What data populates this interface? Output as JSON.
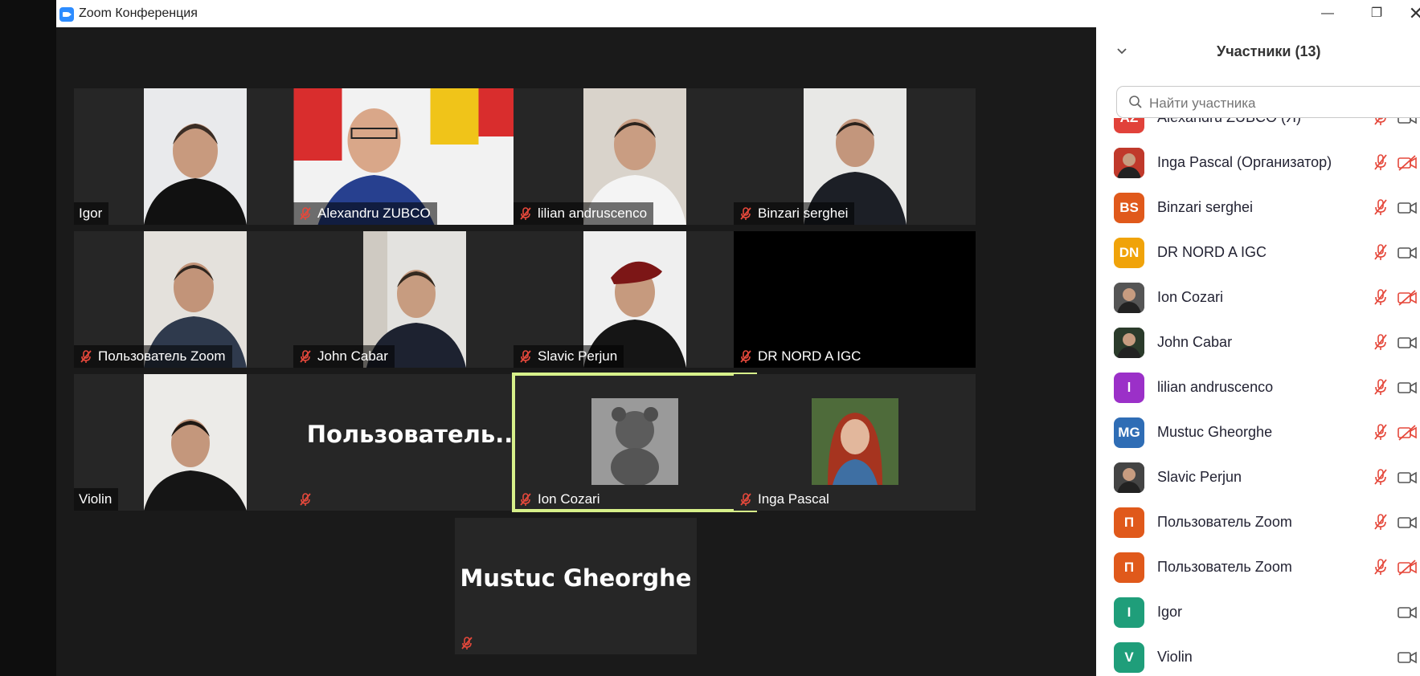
{
  "window": {
    "title": "Zoom Конференция"
  },
  "tiles": [
    {
      "name": "Igor",
      "muted": false,
      "video": true
    },
    {
      "name": "Alexandru ZUBCO",
      "muted": true,
      "video": true
    },
    {
      "name": "lilian andruscenco",
      "muted": true,
      "video": true
    },
    {
      "name": "Binzari serghei",
      "muted": true,
      "video": true
    },
    {
      "name": "Пользователь Zoom",
      "muted": true,
      "video": true
    },
    {
      "name": "John Cabar",
      "muted": true,
      "video": true
    },
    {
      "name": "Slavic Perjun",
      "muted": true,
      "video": true
    },
    {
      "name": "DR NORD A IGC",
      "muted": true,
      "video": true
    },
    {
      "name": "Violin",
      "muted": false,
      "video": true
    },
    {
      "name": "Пользователь...",
      "muted": true,
      "video": false
    },
    {
      "name": "Ion Cozari",
      "muted": true,
      "video": false,
      "active_speaker": true
    },
    {
      "name": "Inga Pascal",
      "muted": true,
      "video": false
    },
    {
      "name": "Mustuc Gheorghe",
      "muted": true,
      "video": false
    }
  ],
  "panel": {
    "title": "Участники (13)",
    "search_placeholder": "Найти участника",
    "participants": [
      {
        "name": "Alexandru ZUBCO (Я)",
        "initials": "AZ",
        "color": "#e1423a",
        "mic": "muted",
        "cam": "on"
      },
      {
        "name": "Inga Pascal (Организатор)",
        "initials": "",
        "color": "#c0392b",
        "mic": "muted",
        "cam": "off"
      },
      {
        "name": "Binzari serghei",
        "initials": "BS",
        "color": "#e0591b",
        "mic": "muted",
        "cam": "on"
      },
      {
        "name": "DR NORD A IGC",
        "initials": "DN",
        "color": "#f0a30a",
        "mic": "muted",
        "cam": "on"
      },
      {
        "name": "Ion Cozari",
        "initials": "",
        "color": "#555555",
        "mic": "muted",
        "cam": "off"
      },
      {
        "name": "John Cabar",
        "initials": "",
        "color": "#2b3b2b",
        "mic": "muted",
        "cam": "on"
      },
      {
        "name": "lilian andruscenco",
        "initials": "l",
        "color": "#9b30c8",
        "mic": "muted",
        "cam": "on"
      },
      {
        "name": "Mustuc Gheorghe",
        "initials": "MG",
        "color": "#2f6db5",
        "mic": "muted",
        "cam": "off"
      },
      {
        "name": "Slavic Perjun",
        "initials": "",
        "color": "#444444",
        "mic": "muted",
        "cam": "on"
      },
      {
        "name": "Пользователь Zoom",
        "initials": "П",
        "color": "#e0591b",
        "mic": "muted",
        "cam": "on"
      },
      {
        "name": "Пользователь Zoom",
        "initials": "П",
        "color": "#e0591b",
        "mic": "muted",
        "cam": "off"
      },
      {
        "name": "Igor",
        "initials": "I",
        "color": "#1f9e7a",
        "mic": "none",
        "cam": "on"
      },
      {
        "name": "Violin",
        "initials": "V",
        "color": "#1f9e7a",
        "mic": "none",
        "cam": "on"
      }
    ]
  }
}
